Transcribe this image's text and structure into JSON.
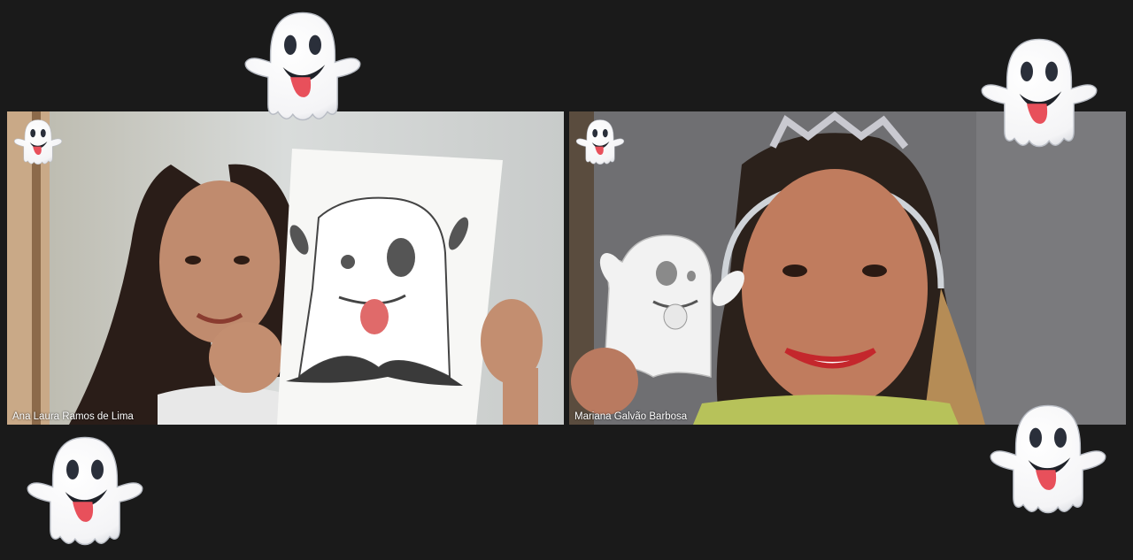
{
  "meeting": {
    "participants": [
      {
        "name": "Ana Laura Ramos de Lima"
      },
      {
        "name": "Mariana Galvão Barbosa"
      }
    ]
  },
  "reactions": {
    "emoji_name": "ghost-emoji",
    "glyph": "👻"
  },
  "colors": {
    "background": "#1a1a1a",
    "label_text": "#ffffff",
    "ghost_tongue": "#e8505b"
  }
}
